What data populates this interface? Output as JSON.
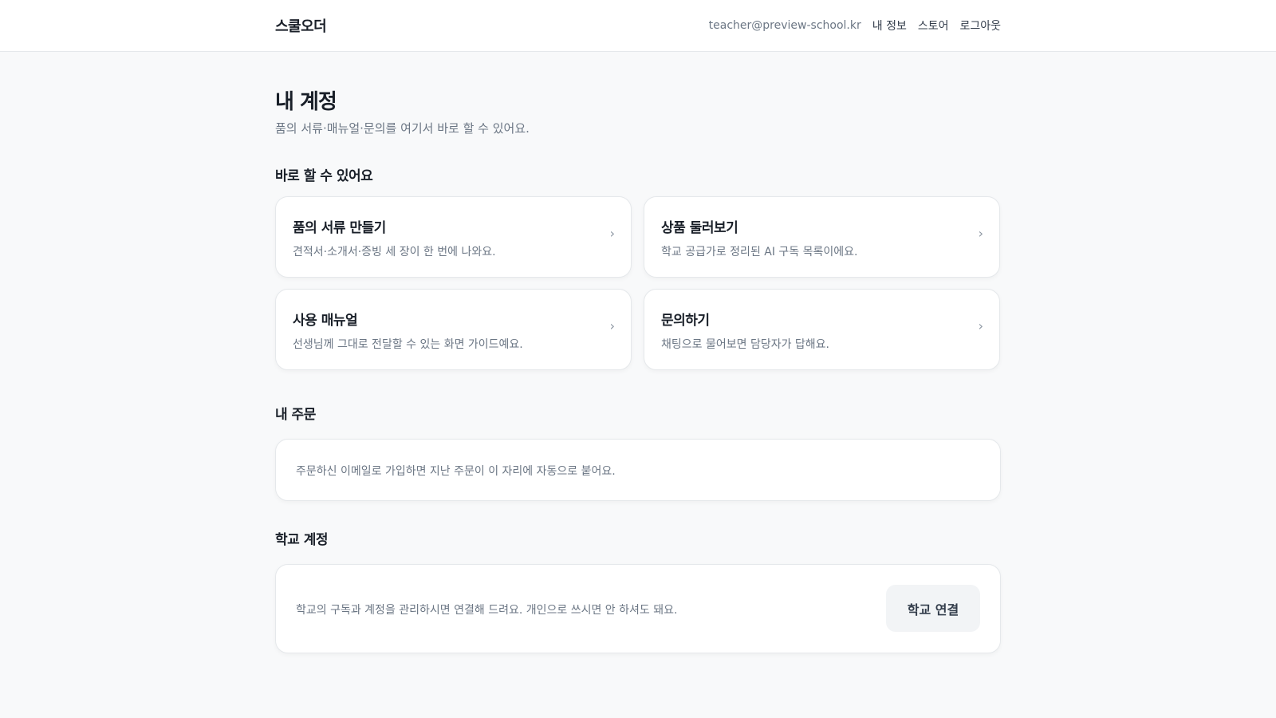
{
  "header": {
    "brand": "스쿨오더",
    "email": "teacher@preview-school.kr",
    "nav": [
      "내 정보",
      "스토어",
      "로그아웃"
    ]
  },
  "page": {
    "title": "내 계정",
    "subtitle": "품의 서류·매뉴얼·문의를 여기서 바로 할 수 있어요."
  },
  "quick": {
    "title": "바로 할 수 있어요",
    "cards": [
      {
        "title": "품의 서류 만들기",
        "desc": "견적서·소개서·증빙 세 장이 한 번에 나와요."
      },
      {
        "title": "상품 둘러보기",
        "desc": "학교 공급가로 정리된 AI 구독 목록이에요."
      },
      {
        "title": "사용 매뉴얼",
        "desc": "선생님께 그대로 전달할 수 있는 화면 가이드예요."
      },
      {
        "title": "문의하기",
        "desc": "채팅으로 물어보면 담당자가 답해요."
      }
    ],
    "chevron": "›"
  },
  "orders": {
    "title": "내 주문",
    "empty_text": "주문하신 이메일로 가입하면 지난 주문이 이 자리에 자동으로 붙어요."
  },
  "school": {
    "title": "학교 계정",
    "text": "학교의 구독과 계정을 관리하시면 연결해 드려요. 개인으로 쓰시면 안 하셔도 돼요.",
    "button": "학교 연결"
  }
}
